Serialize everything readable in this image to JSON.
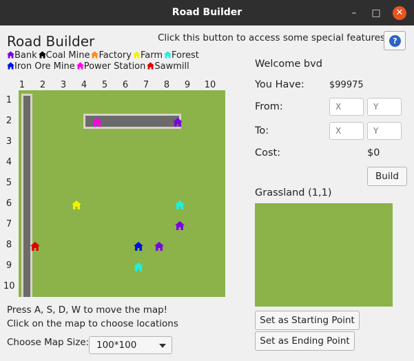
{
  "window": {
    "title": "Road Builder",
    "minimize": "–",
    "maximize": "□",
    "close": "✕"
  },
  "app_title": "Road Builder",
  "special_hint": "Click this button to access some special features!",
  "help_button": "?",
  "legend": {
    "row1": [
      {
        "label": "Bank",
        "color": "#7a00e6",
        "icon": "house-icon"
      },
      {
        "label": "Coal Mine",
        "color": "#000000",
        "icon": "house-icon"
      },
      {
        "label": "Factory",
        "color": "#ff8c1a",
        "icon": "house-icon"
      },
      {
        "label": "Farm",
        "color": "#f2f200",
        "icon": "house-icon"
      },
      {
        "label": "Forest",
        "color": "#1ef0e0",
        "icon": "house-icon"
      }
    ],
    "row2": [
      {
        "label": "Iron Ore Mine",
        "color": "#0010e0",
        "icon": "house-icon"
      },
      {
        "label": "Power Station",
        "color": "#ff00e6",
        "icon": "house-icon"
      },
      {
        "label": "Sawmill",
        "color": "#e00000",
        "icon": "house-icon"
      }
    ]
  },
  "grid": {
    "columns": [
      "1",
      "2",
      "3",
      "4",
      "5",
      "6",
      "7",
      "8",
      "9",
      "10"
    ],
    "rows": [
      "1",
      "2",
      "3",
      "4",
      "5",
      "6",
      "7",
      "8",
      "9",
      "10"
    ]
  },
  "map_buildings": [
    {
      "type": "Power Station",
      "col": 4.3,
      "row": 2,
      "color": "#ff00e6"
    },
    {
      "type": "Bank",
      "col": 8.2,
      "row": 2,
      "color": "#7a00e6"
    },
    {
      "type": "Farm",
      "col": 3.3,
      "row": 6,
      "color": "#f2f200"
    },
    {
      "type": "Forest",
      "col": 8.3,
      "row": 6,
      "color": "#1ef0e0"
    },
    {
      "type": "Bank",
      "col": 8.3,
      "row": 7,
      "color": "#7a00e6"
    },
    {
      "type": "Sawmill",
      "col": 1.3,
      "row": 8,
      "color": "#e00000"
    },
    {
      "type": "Iron Ore Mine",
      "col": 6.3,
      "row": 8,
      "color": "#0010e0"
    },
    {
      "type": "Bank",
      "col": 7.3,
      "row": 8,
      "color": "#7a00e6"
    },
    {
      "type": "Forest",
      "col": 6.3,
      "row": 9,
      "color": "#1ef0e0"
    }
  ],
  "welcome": "Welcome bvd",
  "you_have_label": "You Have:",
  "money": "$99975",
  "from_label": "From:",
  "to_label": "To:",
  "x_placeholder": "X",
  "y_placeholder": "Y",
  "cost_label": "Cost:",
  "cost_value": "$0",
  "build_button": "Build",
  "tile_info": "Grassland (1,1)",
  "tile_color": "#8bb34a",
  "set_start_button": "Set as Starting Point",
  "set_end_button": "Set as Ending Point",
  "instructions": [
    "Press A, S, D, W to move the map!",
    "Click on the map to choose locations"
  ],
  "map_size_label": "Choose Map Size:",
  "map_size_value": "100*100",
  "colors": {
    "grass": "#8bb34a",
    "road": "#6b6b6b",
    "road_border": "#d9d4c4",
    "accent": "#e95420"
  }
}
